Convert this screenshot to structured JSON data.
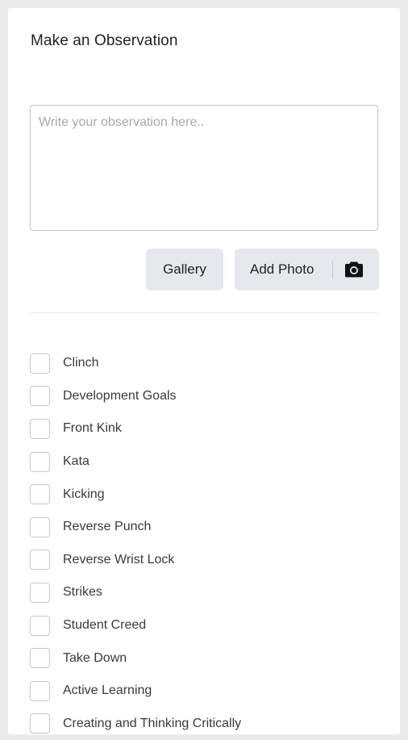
{
  "form": {
    "title": "Make an Observation",
    "observation_placeholder": "Write your observation here..",
    "observation_value": ""
  },
  "actions": {
    "gallery_label": "Gallery",
    "add_photo_label": "Add Photo",
    "add_photo_icon": "camera-icon"
  },
  "tags": [
    {
      "label": "Clinch",
      "checked": false
    },
    {
      "label": "Development Goals",
      "checked": false
    },
    {
      "label": "Front Kink",
      "checked": false
    },
    {
      "label": "Kata",
      "checked": false
    },
    {
      "label": "Kicking",
      "checked": false
    },
    {
      "label": "Reverse Punch",
      "checked": false
    },
    {
      "label": "Reverse Wrist Lock",
      "checked": false
    },
    {
      "label": "Strikes",
      "checked": false
    },
    {
      "label": "Student Creed",
      "checked": false
    },
    {
      "label": "Take Down",
      "checked": false
    },
    {
      "label": "Active Learning",
      "checked": false
    },
    {
      "label": "Creating and Thinking Critically",
      "checked": false
    }
  ],
  "colors": {
    "page_background": "#ececec",
    "card_background": "#ffffff",
    "button_background": "#e5e9ee",
    "checkbox_border": "#c8c8c8"
  }
}
